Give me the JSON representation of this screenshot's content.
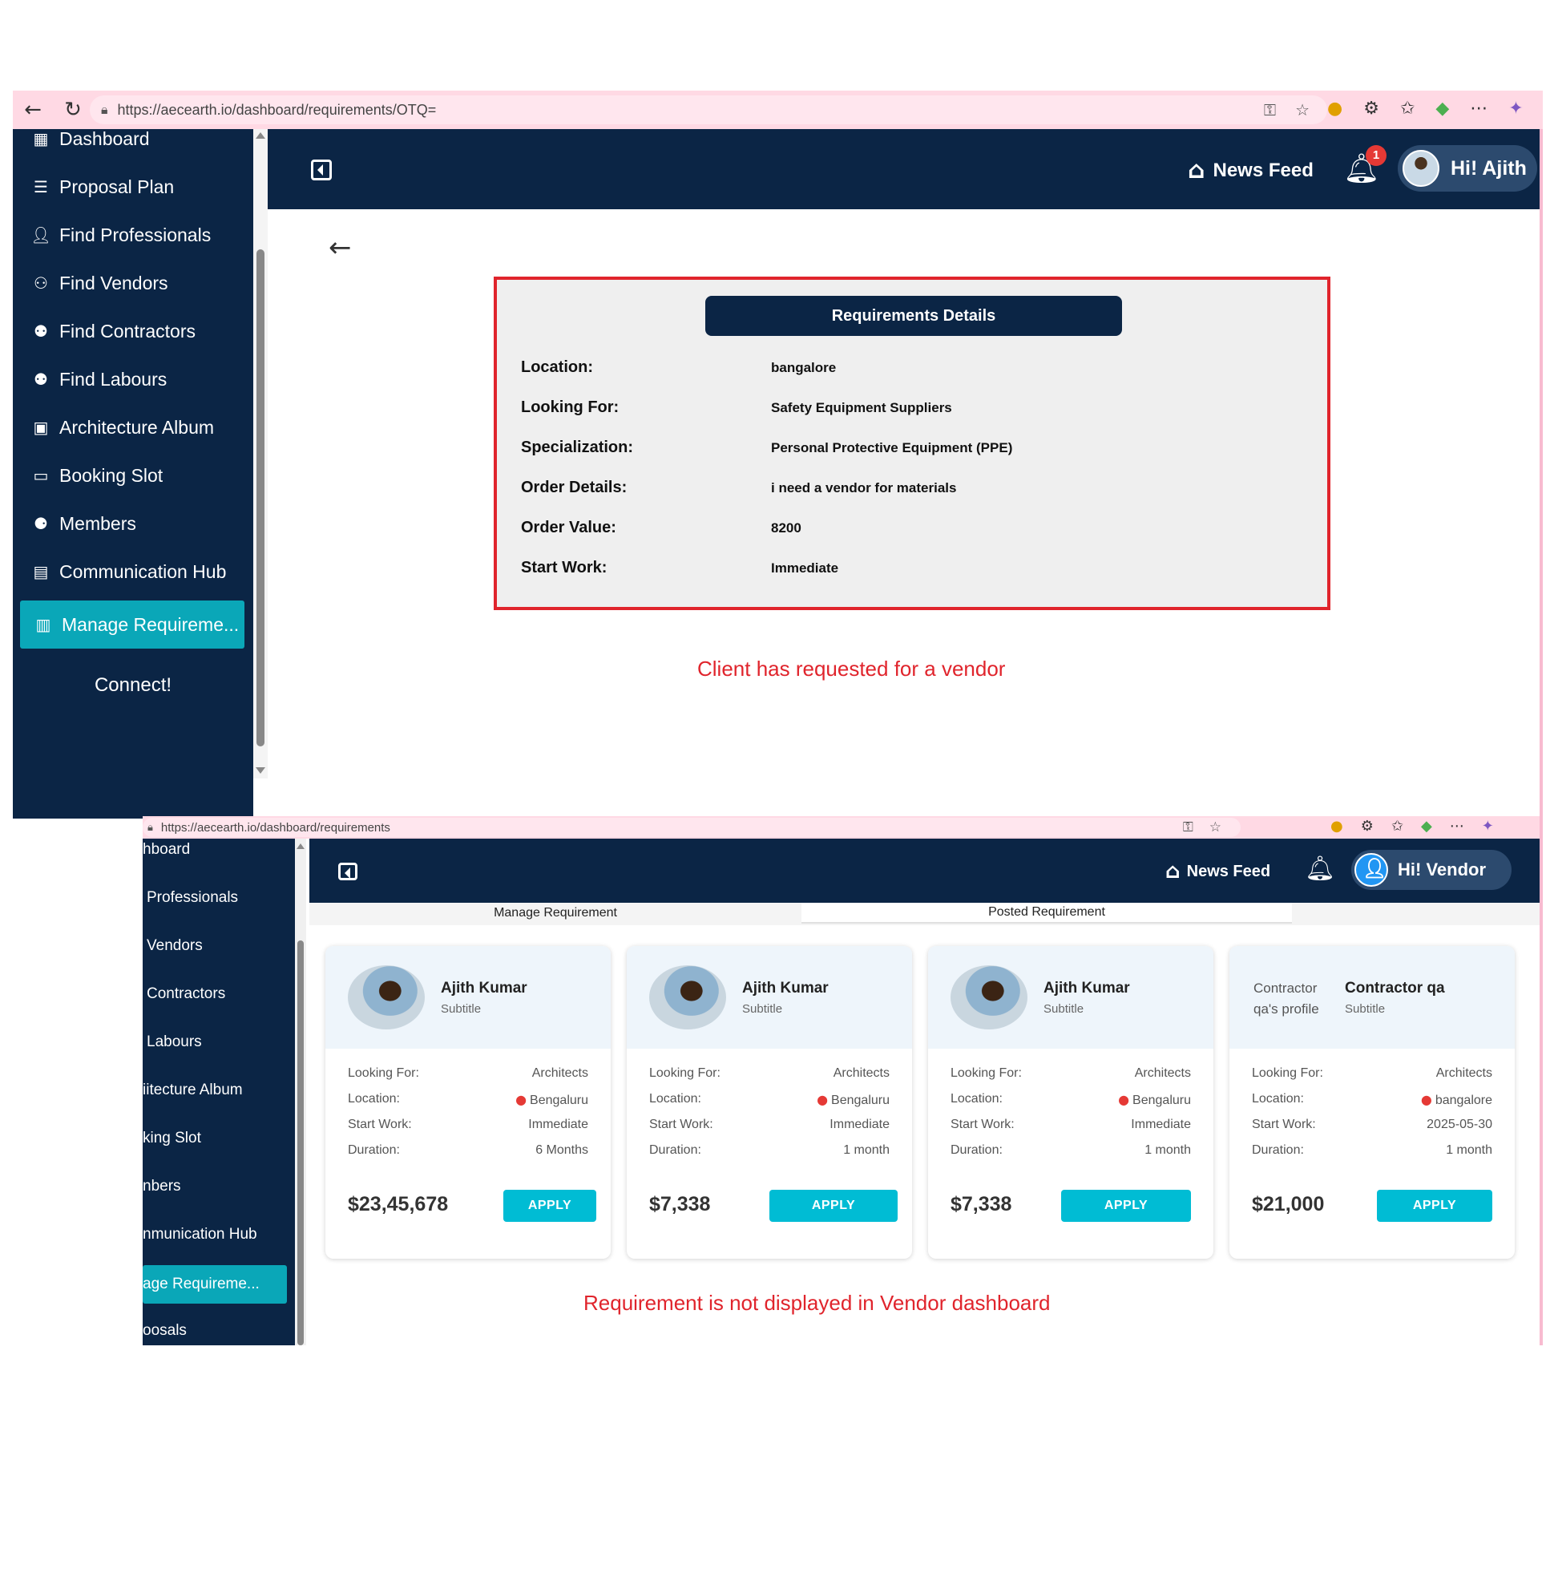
{
  "shot1": {
    "url": "https://aecearth.io/dashboard/requirements/OTQ=",
    "sidebar": [
      {
        "label": "Dashboard",
        "icon": "grid-icon"
      },
      {
        "label": "Proposal Plan",
        "icon": "proposal-icon"
      },
      {
        "label": "Find Professionals",
        "icon": "professionals-icon"
      },
      {
        "label": "Find Vendors",
        "icon": "vendors-icon"
      },
      {
        "label": "Find Contractors",
        "icon": "contractors-icon"
      },
      {
        "label": "Find Labours",
        "icon": "labours-icon"
      },
      {
        "label": "Architecture Album",
        "icon": "album-icon"
      },
      {
        "label": "Booking Slot",
        "icon": "calendar-icon"
      },
      {
        "label": "Members",
        "icon": "members-icon"
      },
      {
        "label": "Communication Hub",
        "icon": "chat-icon"
      },
      {
        "label": "Manage Requireme...",
        "icon": "clipboard-icon"
      }
    ],
    "connect_label": "Connect!",
    "news_feed": "News Feed",
    "notification_count": "1",
    "greeting": "Hi! Ajith",
    "requirements_title": "Requirements Details",
    "details": [
      {
        "label": "Location:",
        "value": "bangalore"
      },
      {
        "label": "Looking For:",
        "value": "Safety Equipment Suppliers"
      },
      {
        "label": "Specialization:",
        "value": "Personal Protective Equipment (PPE)"
      },
      {
        "label": "Order Details:",
        "value": "i need a vendor for materials"
      },
      {
        "label": "Order Value:",
        "value": "8200"
      },
      {
        "label": "Start Work:",
        "value": "Immediate"
      }
    ],
    "note": "Client has requested for a vendor"
  },
  "shot2": {
    "url": "https://aecearth.io/dashboard/requirements",
    "sidebar": [
      "hboard",
      "Professionals",
      "Vendors",
      "Contractors",
      "Labours",
      "iitecture Album",
      "king Slot",
      "nbers",
      "nmunication Hub",
      "age Requireme...",
      "oosals"
    ],
    "news_feed": "News Feed",
    "greeting": "Hi! Vendor",
    "tabs": [
      "Manage Requirement",
      "Posted Requirement"
    ],
    "cards": [
      {
        "name": "Ajith Kumar",
        "subtitle": "Subtitle",
        "avatar_alt": "",
        "looking_for": "Architects",
        "location": "Bengaluru",
        "start_work": "Immediate",
        "duration": "6 Months",
        "price": "$23,45,678",
        "apply": "APPLY"
      },
      {
        "name": "Ajith Kumar",
        "subtitle": "Subtitle",
        "avatar_alt": "",
        "looking_for": "Architects",
        "location": "Bengaluru",
        "start_work": "Immediate",
        "duration": "1 month",
        "price": "$7,338",
        "apply": "APPLY"
      },
      {
        "name": "Ajith Kumar",
        "subtitle": "Subtitle",
        "avatar_alt": "",
        "looking_for": "Architects",
        "location": "Bengaluru",
        "start_work": "Immediate",
        "duration": "1 month",
        "price": "$7,338",
        "apply": "APPLY"
      },
      {
        "name": "Contractor qa",
        "subtitle": "Subtitle",
        "avatar_alt": "Contractor qa's profile",
        "looking_for": "Architects",
        "location": "bangalore",
        "start_work": "2025-05-30",
        "duration": "1 month",
        "price": "$21,000",
        "apply": "APPLY"
      }
    ],
    "labels": {
      "looking_for": "Looking For:",
      "location": "Location:",
      "start_work": "Start Work:",
      "duration": "Duration:"
    },
    "note": "Requirement is not displayed in Vendor dashboard"
  },
  "colors": {
    "navy": "#0b2545",
    "teal": "#0aa7b8",
    "apply": "#00bcd4",
    "highlight_red": "#e0242c",
    "browser_pink": "#ffd9e4"
  }
}
